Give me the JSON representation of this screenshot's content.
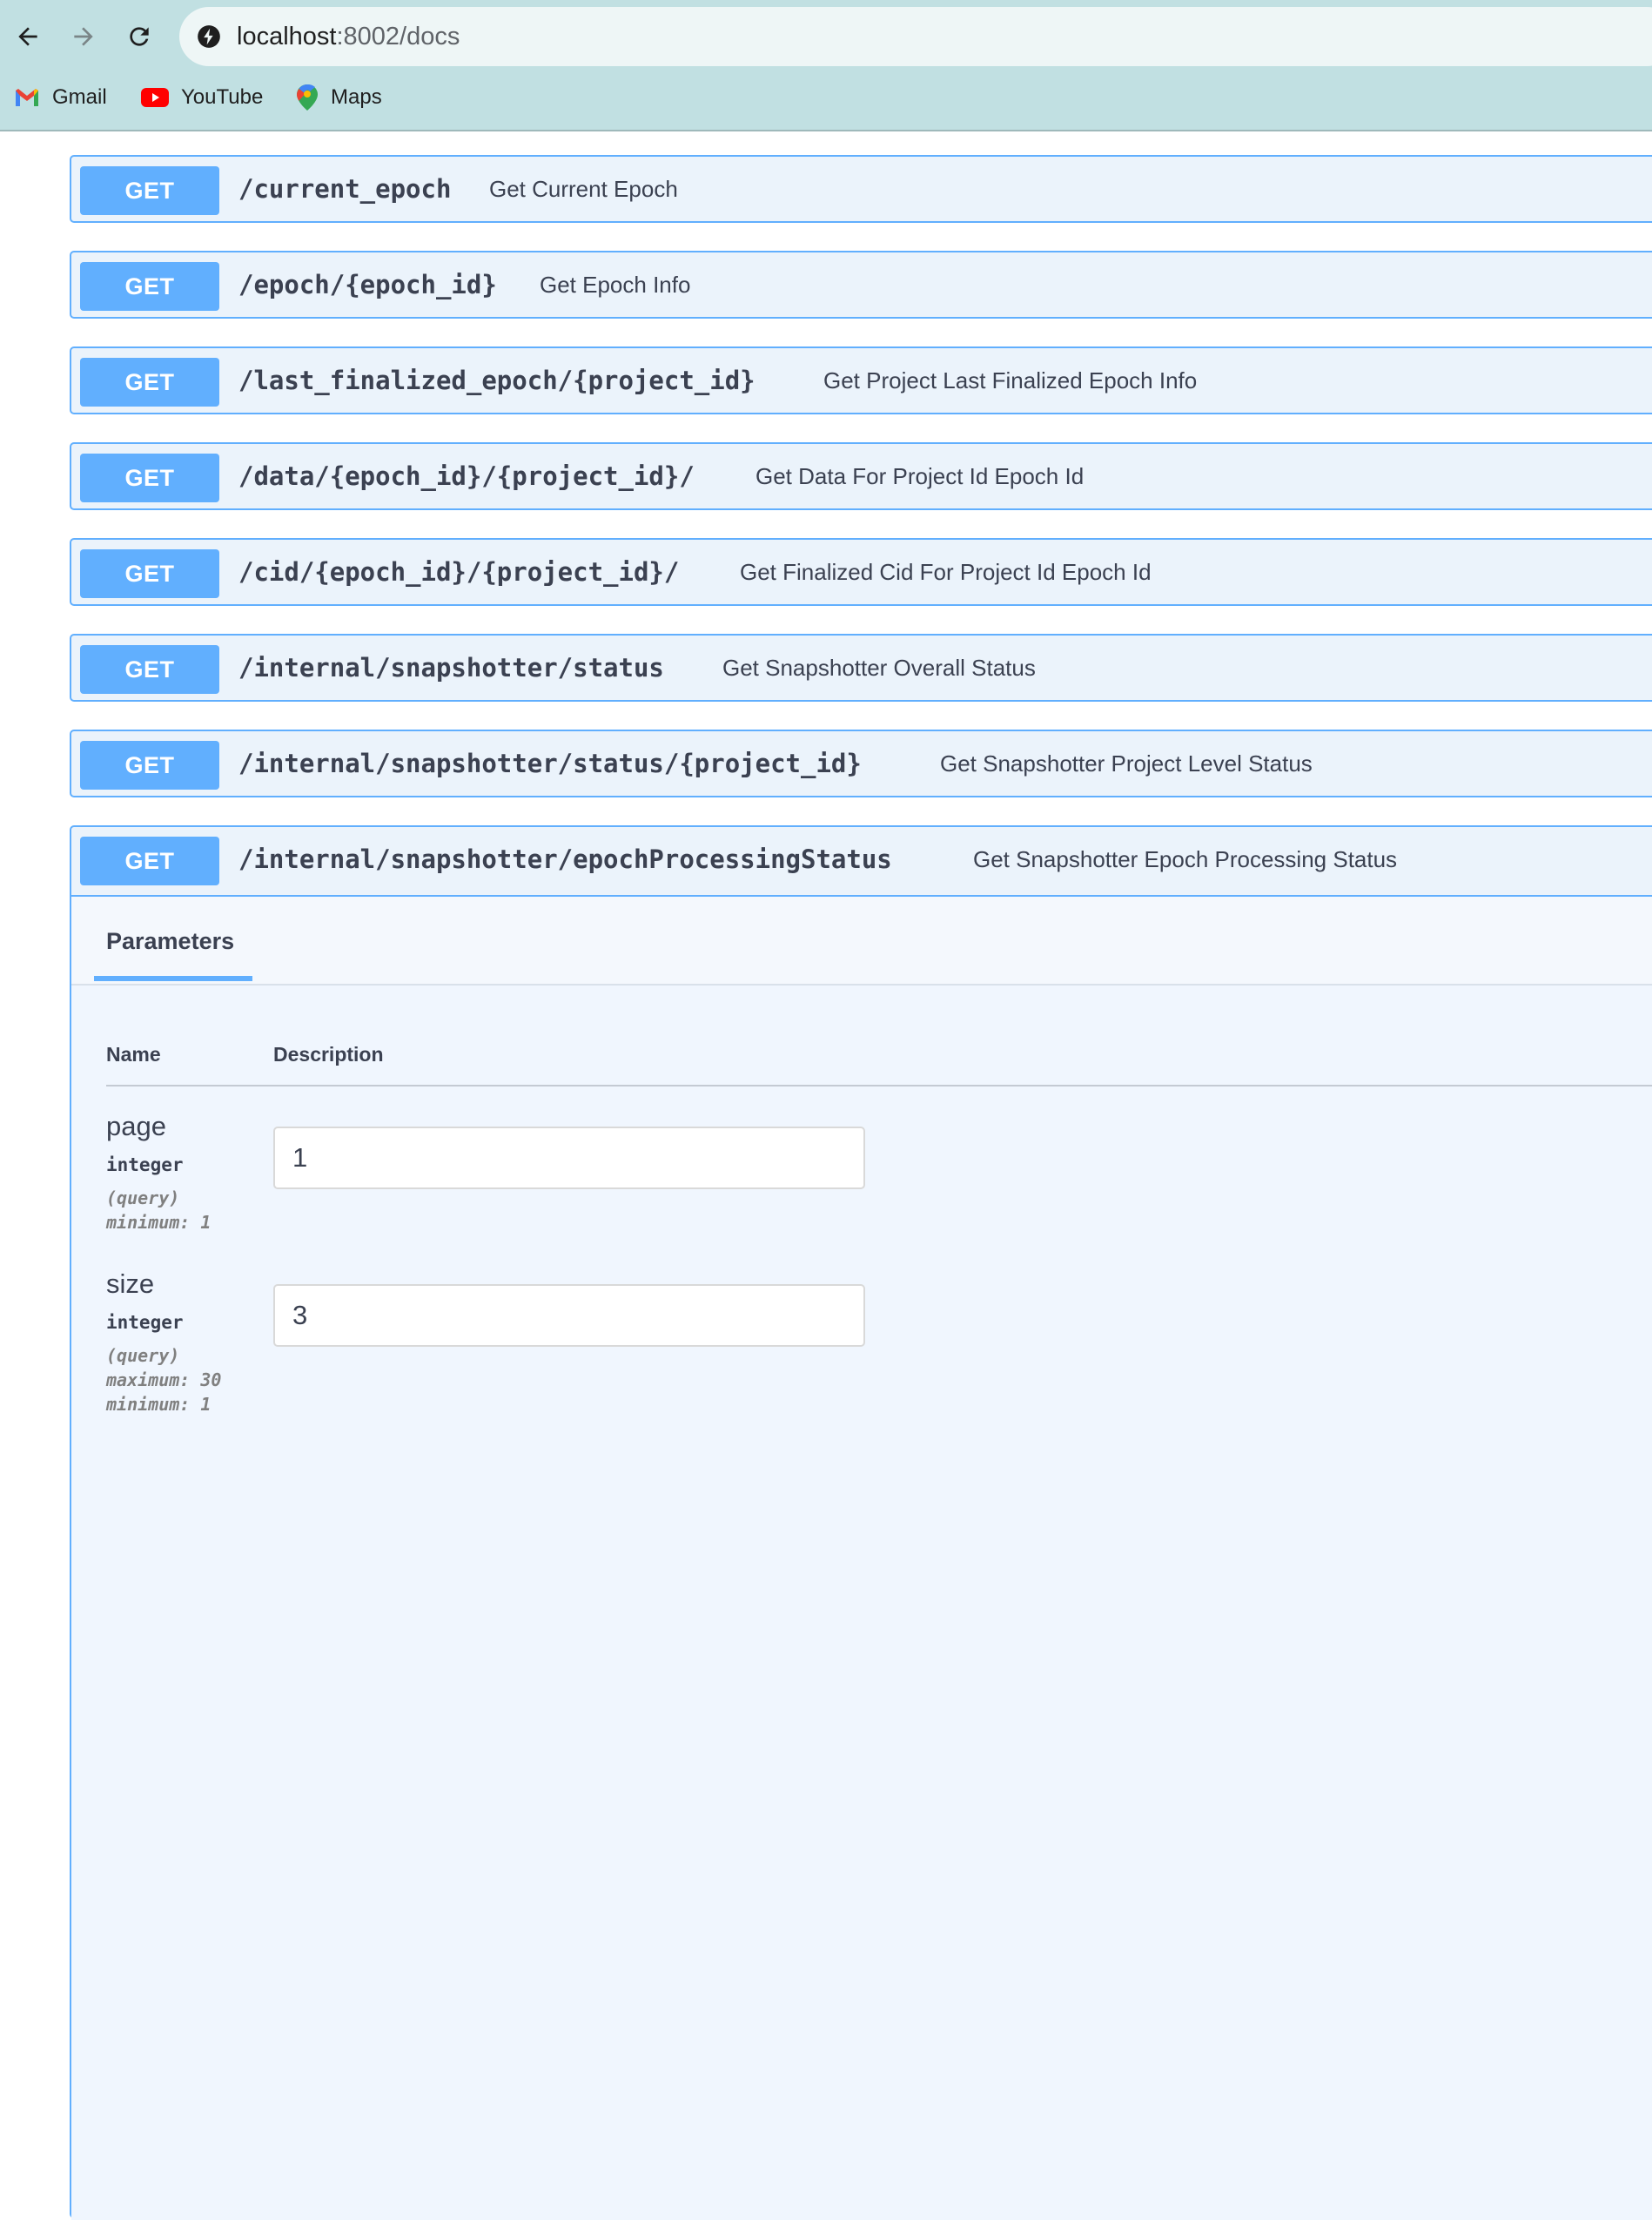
{
  "browser": {
    "url_host": "localhost",
    "url_rest": ":8002/docs",
    "icons": {
      "back": "arrow-left-icon",
      "forward": "arrow-right-icon",
      "reload": "reload-icon",
      "site_info": "site-info-icon"
    },
    "bookmarks": [
      {
        "label": "Gmail",
        "icon": "gmail-icon"
      },
      {
        "label": "YouTube",
        "icon": "youtube-icon"
      },
      {
        "label": "Maps",
        "icon": "maps-icon"
      }
    ]
  },
  "operations": [
    {
      "method": "GET",
      "path": "/current_epoch",
      "summary": "Get Current Epoch"
    },
    {
      "method": "GET",
      "path": "/epoch/{epoch_id}",
      "summary": "Get Epoch Info"
    },
    {
      "method": "GET",
      "path": "/last_finalized_epoch/{project_id}",
      "summary": "Get Project Last Finalized Epoch Info"
    },
    {
      "method": "GET",
      "path": "/data/{epoch_id}/{project_id}/",
      "summary": "Get Data For Project Id Epoch Id"
    },
    {
      "method": "GET",
      "path": "/cid/{epoch_id}/{project_id}/",
      "summary": "Get Finalized Cid For Project Id Epoch Id"
    },
    {
      "method": "GET",
      "path": "/internal/snapshotter/status",
      "summary": "Get Snapshotter Overall Status"
    },
    {
      "method": "GET",
      "path": "/internal/snapshotter/status/{project_id}",
      "summary": "Get Snapshotter Project Level Status"
    },
    {
      "method": "GET",
      "path": "/internal/snapshotter/epochProcessingStatus",
      "summary": "Get Snapshotter Epoch Processing Status"
    }
  ],
  "expanded": {
    "tab_label": "Parameters",
    "col_name": "Name",
    "col_description": "Description",
    "params": [
      {
        "name": "page",
        "type": "integer",
        "location": "(query)",
        "constraints": [
          "minimum: 1"
        ],
        "value": "1"
      },
      {
        "name": "size",
        "type": "integer",
        "location": "(query)",
        "constraints": [
          "maximum: 30",
          "minimum: 1"
        ],
        "value": "3"
      }
    ]
  },
  "colors": {
    "get_accent": "#61affe",
    "get_bg": "#ebf3fb",
    "chrome_bg": "#c1e0e2",
    "text": "#3b4151"
  }
}
